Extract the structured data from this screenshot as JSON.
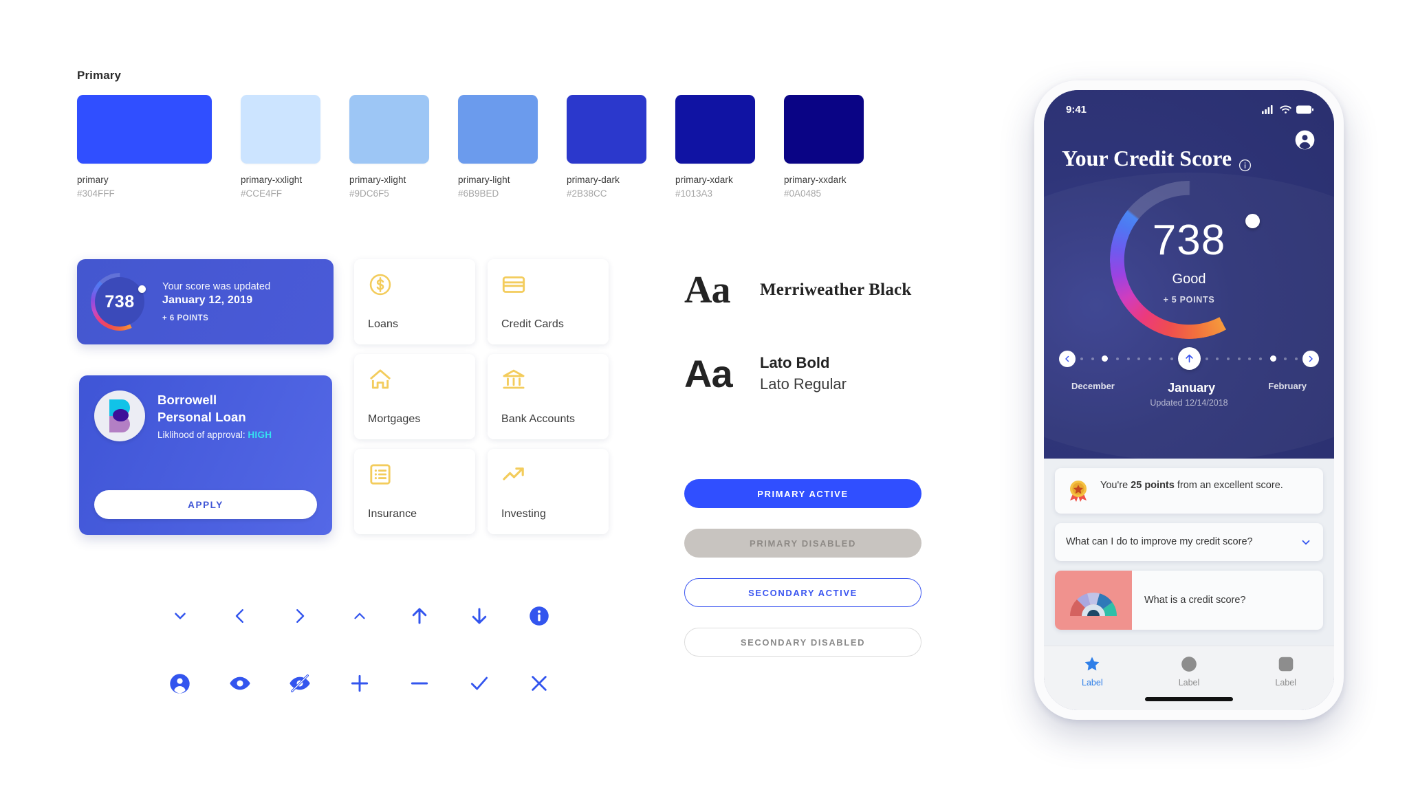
{
  "palette": {
    "title": "Primary",
    "swatches": [
      {
        "name": "primary",
        "hex": "#304FFF",
        "wide": true
      },
      {
        "name": "primary-xxlight",
        "hex": "#CCE4FF",
        "wide": false
      },
      {
        "name": "primary-xlight",
        "hex": "#9DC6F5",
        "wide": false
      },
      {
        "name": "primary-light",
        "hex": "#6B9BED",
        "wide": false
      },
      {
        "name": "primary-dark",
        "hex": "#2B38CC",
        "wide": false
      },
      {
        "name": "primary-xdark",
        "hex": "#1013A3",
        "wide": false
      },
      {
        "name": "primary-xxdark",
        "hex": "#0A0485",
        "wide": false
      }
    ]
  },
  "score_card": {
    "score": "738",
    "line1": "Your score was updated",
    "line2": "January 12, 2019",
    "delta": "+ 6 POINTS"
  },
  "loan_card": {
    "brand": "Borrowell",
    "product": "Personal Loan",
    "likelihood_label": "Liklihood of approval:",
    "likelihood_value": "HIGH",
    "apply_label": "APPLY"
  },
  "tiles": [
    {
      "label": "Loans",
      "icon": "dollar-circle-icon"
    },
    {
      "label": "Credit Cards",
      "icon": "credit-card-icon"
    },
    {
      "label": "Mortgages",
      "icon": "home-icon"
    },
    {
      "label": "Bank Accounts",
      "icon": "bank-icon"
    },
    {
      "label": "Insurance",
      "icon": "list-document-icon"
    },
    {
      "label": "Investing",
      "icon": "trending-up-icon"
    }
  ],
  "typography": {
    "sample": "Aa",
    "serif_name": "Merriweather Black",
    "sans_bold": "Lato Bold",
    "sans_regular": "Lato Regular"
  },
  "buttons": {
    "primary_active": "PRIMARY ACTIVE",
    "primary_disabled": "PRIMARY DISABLED",
    "secondary_active": "SECONDARY ACTIVE",
    "secondary_disabled": "SECONDARY DISABLED"
  },
  "icons": {
    "row1": [
      "chevron-down-icon",
      "chevron-left-icon",
      "chevron-right-icon",
      "chevron-up-icon",
      "arrow-up-icon",
      "arrow-down-icon",
      "info-circle-icon"
    ],
    "row2": [
      "account-circle-icon",
      "eye-icon",
      "eye-off-icon",
      "plus-icon",
      "minus-icon",
      "check-icon",
      "close-icon"
    ]
  },
  "phone": {
    "status": {
      "time": "9:41"
    },
    "title": "Your Credit Score",
    "gauge": {
      "score": "738",
      "rating": "Good",
      "delta": "+ 5 POINTS"
    },
    "timeline": {
      "prev_month": "December",
      "current_month": "January",
      "next_month": "February",
      "updated": "Updated 12/14/2018"
    },
    "info_card": {
      "prefix": "You're ",
      "highlight": "25 points",
      "suffix": " from an excellent score."
    },
    "faq": {
      "question": "What can I do to improve my credit score?"
    },
    "media": {
      "title": "What is a credit score?"
    },
    "tabbar": [
      {
        "label": "Label",
        "icon": "star-icon",
        "active": true
      },
      {
        "label": "Label",
        "icon": "circle-icon",
        "active": false
      },
      {
        "label": "Label",
        "icon": "square-icon",
        "active": false
      }
    ]
  },
  "colors": {
    "primary": "#304FFF",
    "accent_yellow": "#F3CC5C",
    "phone_bg": "#2A2F6E",
    "likelihood_high": "#35E2F0"
  }
}
